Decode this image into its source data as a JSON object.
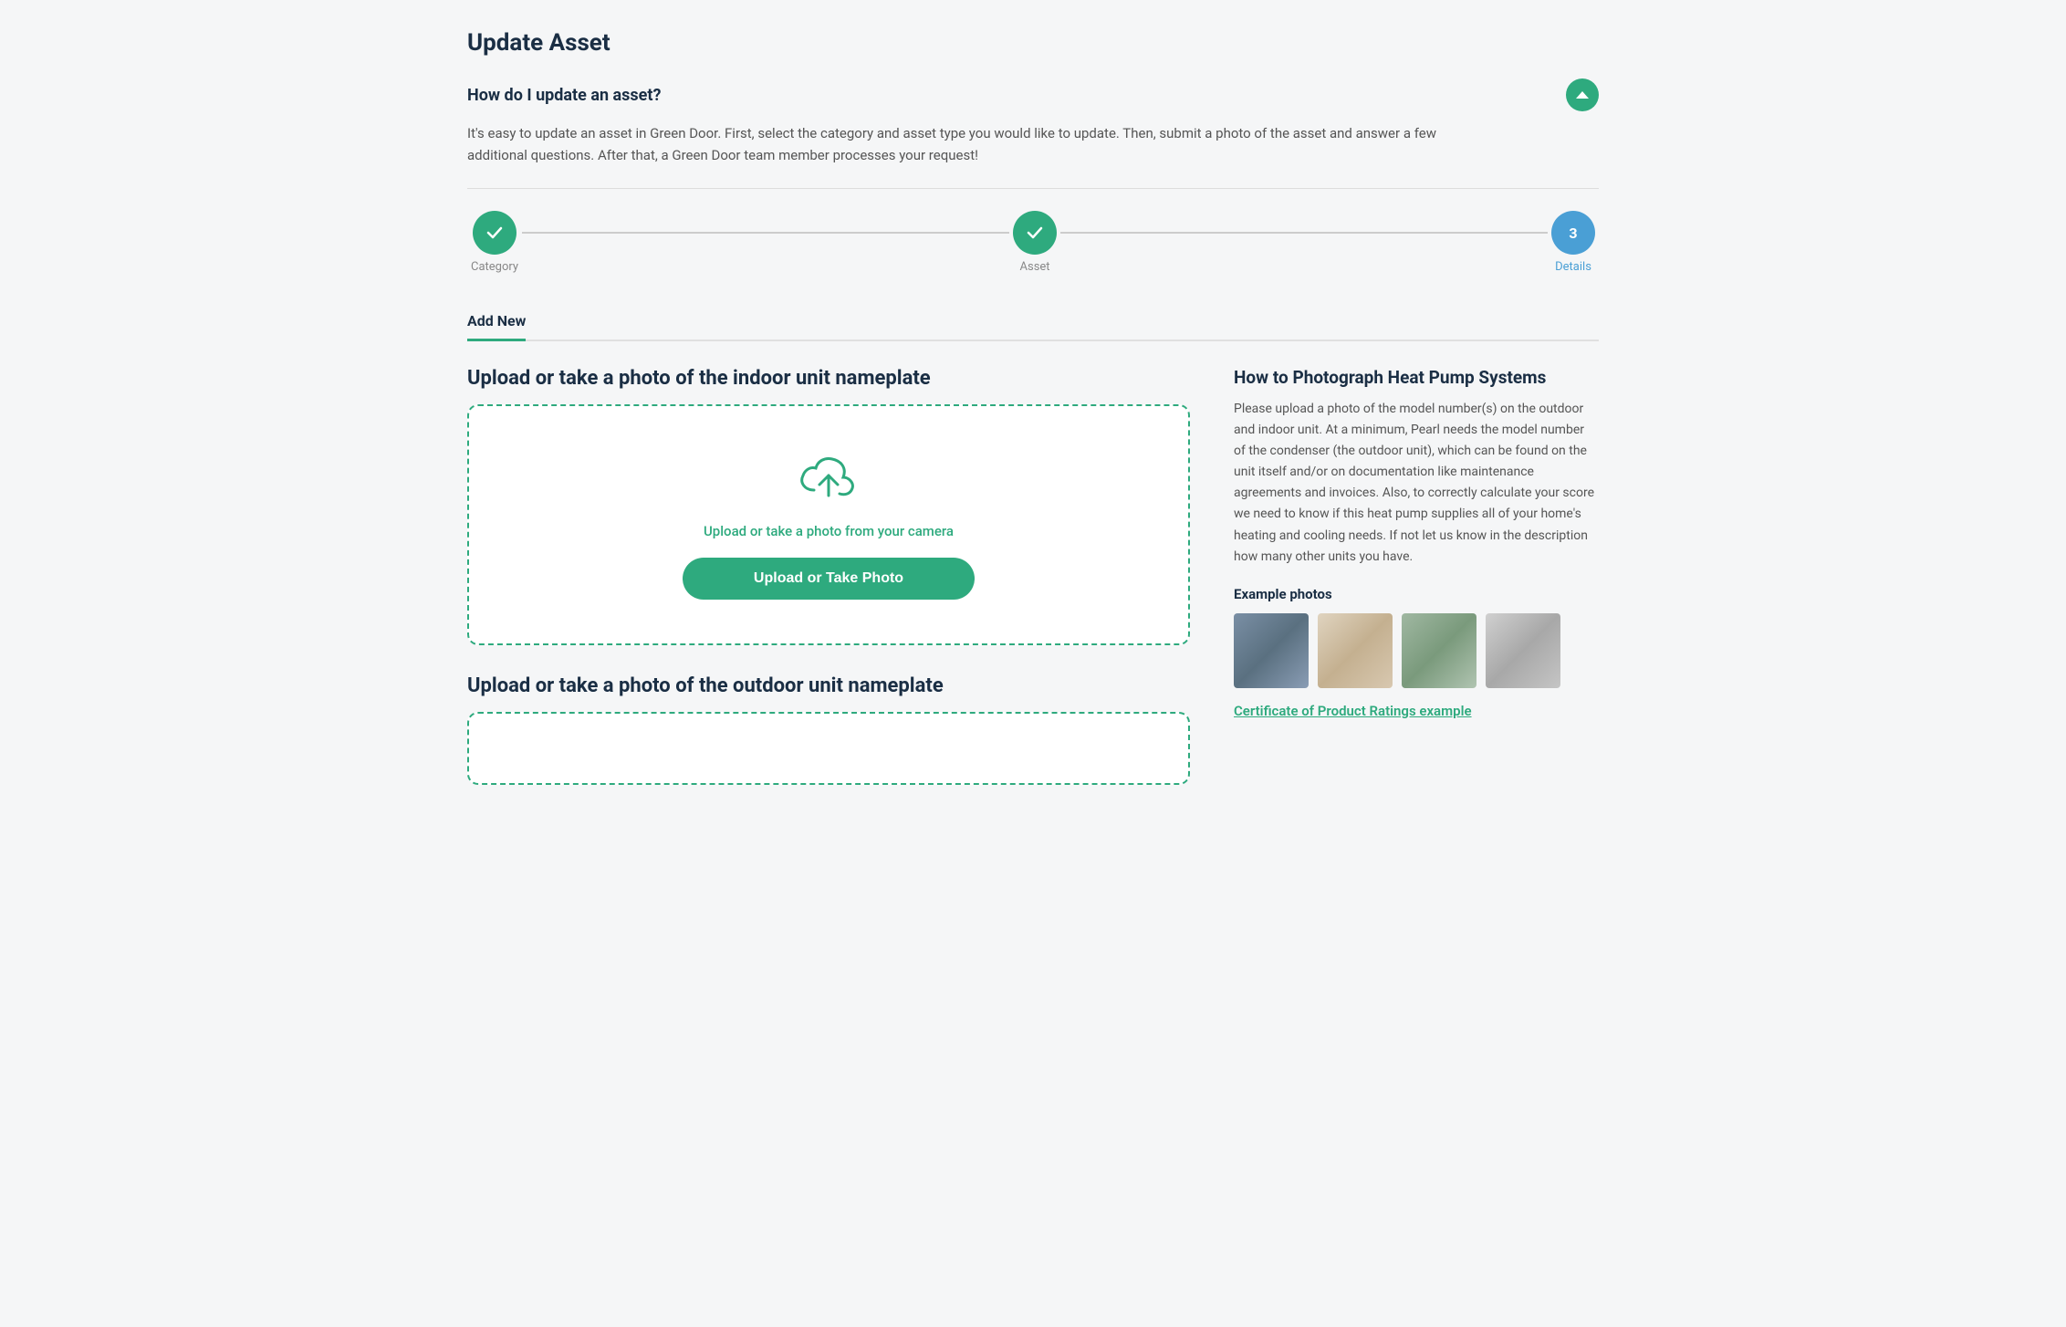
{
  "page": {
    "title": "Update Asset"
  },
  "faq": {
    "question": "How do I update an asset?",
    "answer": "It's easy to update an asset in Green Door. First, select the category and asset type you would like to update. Then, submit a photo of the asset and answer a few additional questions. After that, a Green Door team member processes your request!"
  },
  "stepper": {
    "steps": [
      {
        "id": "category",
        "label": "Category",
        "state": "done",
        "number": "1"
      },
      {
        "id": "asset",
        "label": "Asset",
        "state": "done",
        "number": "2"
      },
      {
        "id": "details",
        "label": "Details",
        "state": "active",
        "number": "3"
      }
    ]
  },
  "tabs": [
    {
      "id": "add-new",
      "label": "Add New",
      "active": true
    }
  ],
  "indoor_upload": {
    "section_title": "Upload or take a photo of the indoor unit nameplate",
    "dropzone_text": "Upload or take a photo from your camera",
    "button_label": "Upload or Take Photo"
  },
  "outdoor_upload": {
    "section_title": "Upload or take a photo of the outdoor unit nameplate"
  },
  "sidebar": {
    "how_to_title": "How to Photograph Heat Pump Systems",
    "how_to_text": "Please upload a photo of the model number(s) on the outdoor and indoor unit. At a minimum, Pearl needs the model number of the condenser (the outdoor unit), which can be found on the unit itself and/or on documentation like maintenance agreements and invoices. Also, to correctly calculate your score we need to know if this heat pump supplies all of your home's heating and cooling needs. If not let us know in the description how many other units you have.",
    "example_photos_label": "Example photos",
    "cert_link_label": "Certificate of Product Ratings example",
    "photos": [
      {
        "id": "photo1",
        "class": "photo1"
      },
      {
        "id": "photo2",
        "class": "photo2"
      },
      {
        "id": "photo3",
        "class": "photo3"
      },
      {
        "id": "photo4",
        "class": "photo4"
      }
    ]
  },
  "icons": {
    "chevron_up": "&#9650;",
    "checkmark": "&#10003;"
  }
}
